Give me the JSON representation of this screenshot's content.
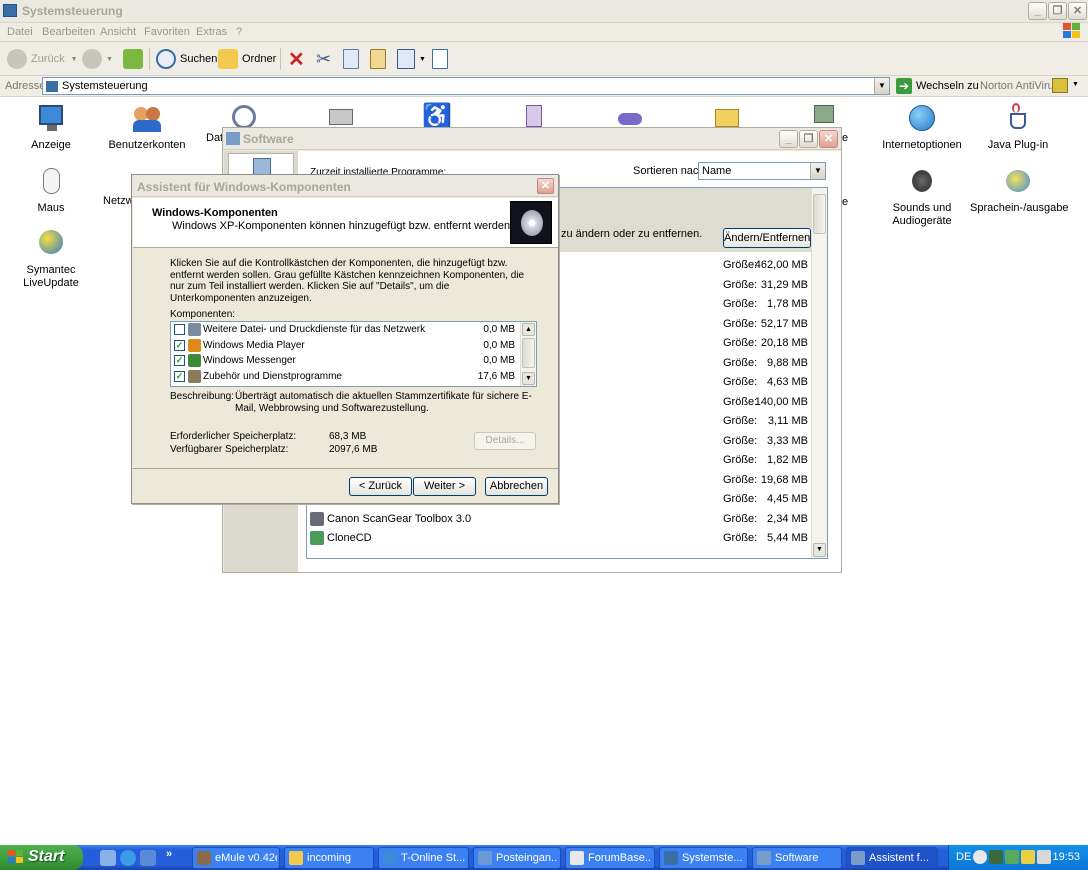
{
  "explorer": {
    "title": "Systemsteuerung",
    "menu": [
      "Datei",
      "Bearbeiten",
      "Ansicht",
      "Favoriten",
      "Extras",
      "?"
    ],
    "toolbar": {
      "back": "Zurück",
      "search": "Suchen",
      "folders": "Ordner"
    },
    "address": {
      "label": "Adresse",
      "value": "Systemsteuerung",
      "go": "Wechseln zu",
      "norton": "Norton AntiVirus"
    }
  },
  "control_panel": {
    "items": [
      "Anzeige",
      "Benutzerkonten",
      "Dat",
      "Internetoptionen",
      "Java Plug-in",
      "Maus",
      "Netzwe",
      "Sounds und Audiogeräte",
      "Sprachein-/ausgabe",
      "Symantec LiveUpdate",
      "e",
      "e"
    ]
  },
  "software": {
    "title": "Software",
    "installed_label": "Zurzeit installierte Programme:",
    "sort_label": "Sortieren nach:",
    "sort_value": "Name",
    "selected_hint": "zu ändern oder zu entfernen.",
    "change_remove": "Ändern/Entfernen",
    "size_label": "Größe:",
    "sizes": [
      "462,00 MB",
      "31,29 MB",
      "1,78 MB",
      "52,17 MB",
      "20,18 MB",
      "9,88 MB",
      "4,63 MB",
      "140,00 MB",
      "3,11 MB",
      "3,33 MB",
      "1,82 MB",
      "19,68 MB",
      "4,45 MB",
      "2,34 MB",
      "5,44 MB"
    ],
    "programs_visible": [
      "Canon ScanGear Toolbox 3.0",
      "CloneCD"
    ]
  },
  "wizard": {
    "title": "Assistent für Windows-Komponenten",
    "heading": "Windows-Komponenten",
    "subheading": "Windows XP-Komponenten können hinzugefügt bzw. entfernt werden.",
    "intro": "Klicken Sie auf die Kontrollkästchen der Komponenten, die hinzugefügt bzw. entfernt werden sollen. Grau gefüllte Kästchen kennzeichnen Komponenten, die nur zum Teil installiert werden. Klicken Sie auf \"Details\", um die Unterkomponenten anzuzeigen.",
    "components_label": "Komponenten:",
    "components": [
      {
        "name": "Weitere Datei- und Druckdienste für das Netzwerk",
        "size": "0,0 MB",
        "checked": false,
        "color": "#7a8aa0"
      },
      {
        "name": "Windows Media Player",
        "size": "0,0 MB",
        "checked": true,
        "color": "#e08a1a"
      },
      {
        "name": "Windows Messenger",
        "size": "0,0 MB",
        "checked": true,
        "color": "#3a8a3a"
      },
      {
        "name": "Zubehör und Dienstprogramme",
        "size": "17,6 MB",
        "checked": true,
        "color": "#8a7a5a"
      }
    ],
    "description_label": "Beschreibung:",
    "description": "Überträgt automatisch die aktuellen Stammzertifikate für sichere E-Mail, Webbrowsing und Softwarezustellung.",
    "required_label": "Erforderlicher Speicherplatz:",
    "required_value": "68,3 MB",
    "available_label": "Verfügbarer Speicherplatz:",
    "available_value": "2097,6 MB",
    "details": "Details...",
    "back": "< Zurück",
    "next": "Weiter >",
    "cancel": "Abbrechen"
  },
  "taskbar": {
    "start": "Start",
    "tasks": [
      "eMule v0.42e",
      "incoming",
      "T-Online St...",
      "Posteingan...",
      "ForumBase...",
      "Systemste...",
      "Software",
      "Assistent f..."
    ],
    "lang": "DE",
    "clock": "19:53"
  }
}
